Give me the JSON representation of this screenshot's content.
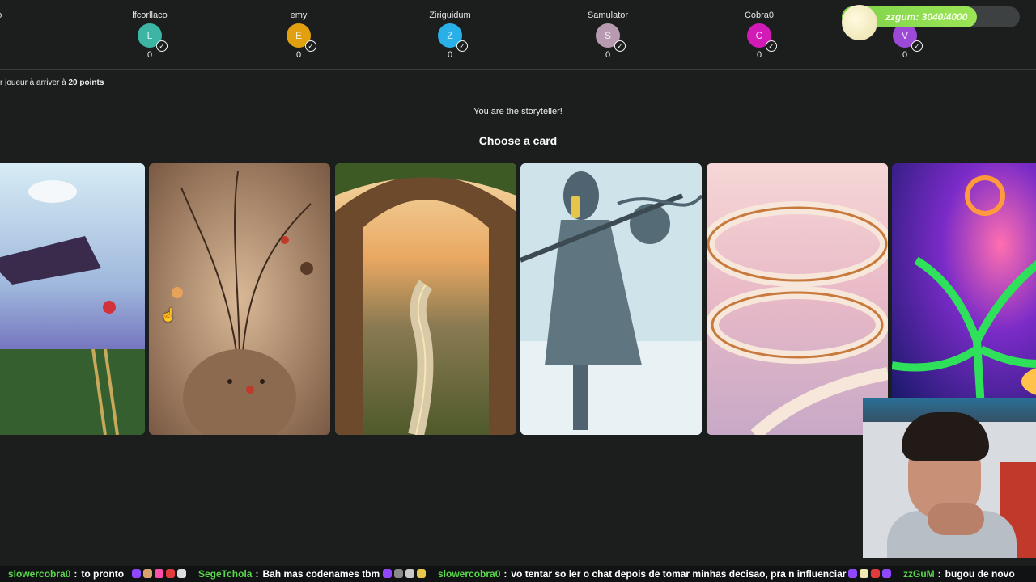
{
  "players": [
    {
      "name": "ano",
      "initial": "",
      "score": "",
      "color": "#1c1d1d"
    },
    {
      "name": "lfcorllaco",
      "initial": "L",
      "score": "0",
      "color": "#3cb5a4"
    },
    {
      "name": "emy",
      "initial": "E",
      "score": "0",
      "color": "#e0a00f"
    },
    {
      "name": "Ziriguidum",
      "initial": "Z",
      "score": "0",
      "color": "#2ab0e8"
    },
    {
      "name": "Samulator",
      "initial": "S",
      "score": "0",
      "color": "#b79aaf"
    },
    {
      "name": "Cobra0",
      "initial": "C",
      "score": "0",
      "color": "#d21ab7"
    },
    {
      "name": "",
      "initial": "V",
      "score": "0",
      "color": "#9b49d6"
    }
  ],
  "overlay": {
    "progress_label": "zzgum: 3040/4000",
    "progress_value": 3040,
    "progress_max": 4000
  },
  "game": {
    "rule_prefix": "r joueur à arriver à ",
    "rule_points": "20 points",
    "storyteller": "You are the storyteller!",
    "choose": "Choose a card"
  },
  "cards": [
    {
      "icon": "dreamer-floating-card"
    },
    {
      "icon": "lantern-creature-card"
    },
    {
      "icon": "stone-arch-road-card"
    },
    {
      "icon": "armored-wanderer-card"
    },
    {
      "icon": "spiral-staircase-card"
    },
    {
      "icon": "glowing-tree-card"
    }
  ],
  "chat": [
    {
      "user": "slowercobra0",
      "sep": ":",
      "msg": "to pronto"
    },
    {
      "user": "SegeTchola",
      "sep": ":",
      "msg": "Bah mas codenames tbm"
    },
    {
      "user": "slowercobra0",
      "sep": ":",
      "msg": "vo tentar so ler o chat depois de tomar minhas decisao, pra n influenciar"
    },
    {
      "user": "zzGuM",
      "sep": ":",
      "msg": "bugou de novo"
    }
  ],
  "colors": {
    "background": "#1c1d1d",
    "chat_user": "#58d84a",
    "progress_fill": "#8ddc4f"
  }
}
